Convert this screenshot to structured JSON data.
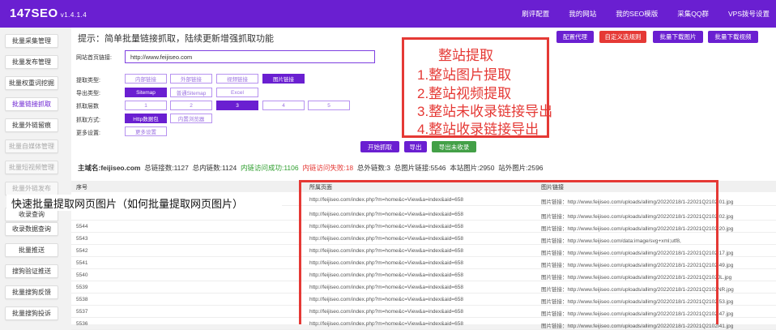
{
  "header": {
    "logo": "147SEO",
    "version": "v1.4.1.4",
    "nav": [
      "刷评配置",
      "我的网站",
      "我的SEO模版",
      "采集QQ群",
      "VPS拨号设置"
    ]
  },
  "sidebar": {
    "items": [
      {
        "label": "批量采集管理",
        "state": "normal"
      },
      {
        "label": "批量发布管理",
        "state": "normal"
      },
      {
        "label": "批量权重词挖掘",
        "state": "normal"
      },
      {
        "label": "批量链接抓取",
        "state": "active"
      },
      {
        "label": "批量外链留痕",
        "state": "normal"
      },
      {
        "label": "批量自媒体管理",
        "state": "disabled"
      },
      {
        "label": "批量短视频管理",
        "state": "disabled"
      },
      {
        "label": "批量外链发布",
        "state": "disabled"
      },
      {
        "label": "收录查询",
        "state": "normal"
      },
      {
        "label": "收录数据查询",
        "state": "normal"
      },
      {
        "label": "批量推送",
        "state": "normal"
      },
      {
        "label": "搜狗验证推送",
        "state": "normal"
      },
      {
        "label": "批量搜狗反馈",
        "state": "normal"
      },
      {
        "label": "批量搜狗投诉",
        "state": "normal"
      }
    ]
  },
  "toolbar": {
    "tip": "提示：简单批量链接抓取，陆续更新增强抓取功能",
    "buttons": [
      "配置代理",
      "自定义选规则",
      "批量下载图片",
      "批量下载视频"
    ]
  },
  "form": {
    "url_label": "网站首页链接:",
    "url_value": "http://www.feijiseo.com",
    "extract_label": "提取类型:",
    "extract_options": [
      "内部链接",
      "外部链接",
      "视频链接",
      "图片链接"
    ],
    "export_label": "导出类型:",
    "export_options": [
      "Sitemap",
      "普通Sitemap",
      "Excel"
    ],
    "layer_label": "抓取层数",
    "layer_options": [
      "1",
      "2",
      "3",
      "4",
      "5"
    ],
    "mode_label": "抓取方式:",
    "mode_options": [
      "Http数据包",
      "内置浏览器"
    ],
    "more_label": "更多设置:",
    "more_button": "更多设置",
    "actions": [
      "开始抓取",
      "导出",
      "导出未收录"
    ]
  },
  "stats": {
    "domain": "主域名:feijiseo.com",
    "total_links": "总链接数:1127",
    "internal_links": "总内链数:1124",
    "visit_ok": "内链访问成功:1106",
    "visit_fail": "内链访问失败:18",
    "external_links": "总外链数:3",
    "total_images": "总图片链接:5546",
    "site_images": "本站图片:2950",
    "offsite_images": "站外图片:2596"
  },
  "table": {
    "headers": [
      "序号",
      "所属页面",
      "图片链接"
    ],
    "rows": [
      {
        "id": "",
        "page": "http://feijiseo.com/index.php?m=home&c=View&a=index&aid=658",
        "img": "图片链接：http://www.feijiseo.com/uploads/allimg/20220218/1-22021Q2102I01.jpg"
      },
      {
        "id": "",
        "page": "http://feijiseo.com/index.php?m=home&c=View&a=index&aid=658",
        "img": "图片链接：http://www.feijiseo.com/uploads/allimg/20220218/1-22021Q2102I02.jpg"
      },
      {
        "id": "5544",
        "page": "http://feijiseo.com/index.php?m=home&c=View&a=index&aid=658",
        "img": "图片链接：http://www.feijiseo.com/uploads/allimg/20220218/1-22021Q2102I20.jpg"
      },
      {
        "id": "5543",
        "page": "http://feijiseo.com/index.php?m=home&c=View&a=index&aid=658",
        "img": "图片链接：http://www.feijiseo.com/data:image/svg+xml;utf8,"
      },
      {
        "id": "5542",
        "page": "http://feijiseo.com/index.php?m=home&c=View&a=index&aid=658",
        "img": "图片链接：http://www.feijiseo.com/uploads/allimg/20220218/1-22021Q2102I17.jpg"
      },
      {
        "id": "5541",
        "page": "http://feijiseo.com/index.php?m=home&c=View&a=index&aid=658",
        "img": "图片链接：http://www.feijiseo.com/uploads/allimg/20220218/1-22021Q2102I49.jpg"
      },
      {
        "id": "5540",
        "page": "http://feijiseo.com/index.php?m=home&c=View&a=index&aid=658",
        "img": "图片链接：http://www.feijiseo.com/uploads/allimg/20220218/1-22021Q2102JL.jpg"
      },
      {
        "id": "5539",
        "page": "http://feijiseo.com/index.php?m=home&c=View&a=index&aid=658",
        "img": "图片链接：http://www.feijiseo.com/uploads/allimg/20220218/1-22021Q2102NR.jpg"
      },
      {
        "id": "5538",
        "page": "http://feijiseo.com/index.php?m=home&c=View&a=index&aid=658",
        "img": "图片链接：http://www.feijiseo.com/uploads/allimg/20220218/1-22021Q2102I53.jpg"
      },
      {
        "id": "5537",
        "page": "http://feijiseo.com/index.php?m=home&c=View&a=index&aid=658",
        "img": "图片链接：http://www.feijiseo.com/uploads/allimg/20220218/1-22021Q2102I47.jpg"
      },
      {
        "id": "5536",
        "page": "http://feijiseo.com/index.php?m=home&c=View&a=index&aid=658",
        "img": "图片链接：http://www.feijiseo.com/uploads/allimg/20220218/1-22021Q2102I41.jpg"
      }
    ]
  },
  "callout": {
    "lines": [
      "整站提取",
      "1.整站图片提取",
      "2.整站视频提取",
      "3.整站未收录链接导出",
      "4.整站收录链接导出"
    ]
  },
  "overlay_title": "快速批量提取网页图片（如何批量提取网页图片）",
  "colors": {
    "accent": "#6a1fd1",
    "red": "#e53935",
    "green": "#43a047"
  }
}
